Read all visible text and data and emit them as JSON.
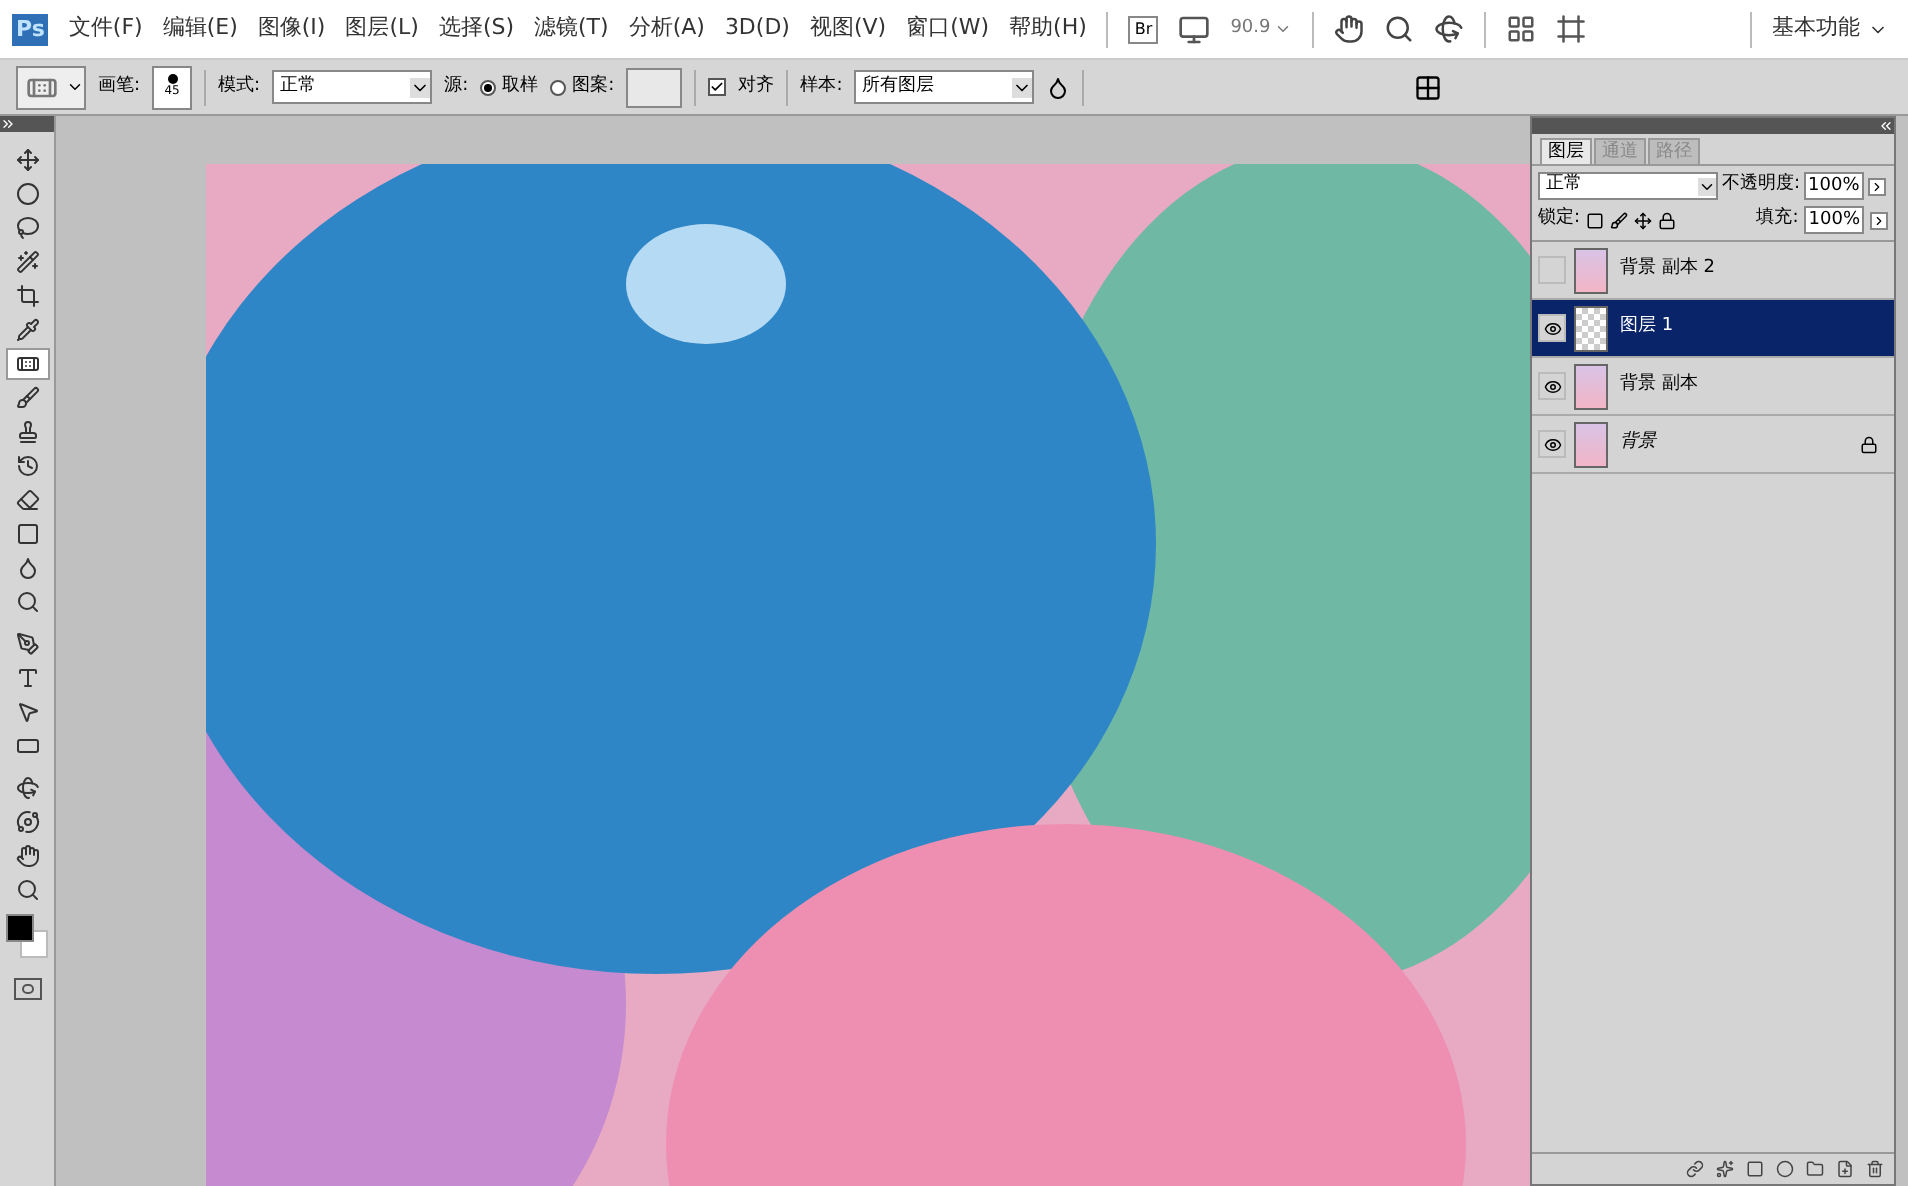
{
  "menu_bar": {
    "logo": "Ps",
    "items": [
      "文件(F)",
      "编辑(E)",
      "图像(I)",
      "图层(L)",
      "选择(S)",
      "滤镜(T)",
      "分析(A)",
      "3D(D)",
      "视图(V)",
      "窗口(W)",
      "帮助(H)"
    ],
    "bridge": "Br",
    "zoom": "90.9",
    "workspace": "基本功能"
  },
  "options_bar": {
    "brush_label": "画笔:",
    "brush_size": "45",
    "mode_label": "模式:",
    "mode_value": "正常",
    "source_label": "源:",
    "sources": [
      {
        "label": "取样",
        "selected": true
      },
      {
        "label": "图案:",
        "selected": false
      }
    ],
    "aligned": {
      "label": "对齐",
      "checked": true
    },
    "sample_label": "样本:",
    "sample_value": "所有图层"
  },
  "toolbox": {
    "tools": [
      {
        "kind": "move",
        "selected": false
      },
      {
        "kind": "marquee",
        "selected": false
      },
      {
        "kind": "lasso",
        "selected": false
      },
      {
        "kind": "wand",
        "selected": false
      },
      {
        "kind": "crop",
        "selected": false
      },
      {
        "kind": "eyedropper",
        "selected": false
      },
      {
        "kind": "healing",
        "selected": true
      },
      {
        "kind": "brush",
        "selected": false
      },
      {
        "kind": "stamp",
        "selected": false
      },
      {
        "kind": "history",
        "selected": false
      },
      {
        "kind": "eraser",
        "selected": false
      },
      {
        "kind": "gradient",
        "selected": false
      },
      {
        "kind": "blur",
        "selected": false
      },
      {
        "kind": "dodge",
        "selected": false
      },
      {
        "kind": "pen",
        "selected": false
      },
      {
        "kind": "type",
        "selected": false
      },
      {
        "kind": "select",
        "selected": false
      },
      {
        "kind": "shape",
        "selected": false
      },
      {
        "kind": "rotate3d",
        "selected": false
      },
      {
        "kind": "orbit3d",
        "selected": false
      },
      {
        "kind": "hand",
        "selected": false
      },
      {
        "kind": "zoom",
        "selected": false
      }
    ]
  },
  "layers_panel": {
    "tabs": [
      {
        "label": "图层",
        "selected": true
      },
      {
        "label": "通道",
        "selected": false
      },
      {
        "label": "路径",
        "selected": false
      }
    ],
    "blend_mode": "正常",
    "opacity_label": "不透明度:",
    "opacity": "100%",
    "lock_label": "锁定:",
    "fill_label": "填充:",
    "fill": "100%",
    "layers": [
      {
        "name": "背景 副本 2",
        "visible": false,
        "selected": false,
        "kind": "photo"
      },
      {
        "name": "图层 1",
        "visible": true,
        "selected": true,
        "kind": "transparent"
      },
      {
        "name": "背景 副本",
        "visible": true,
        "selected": false,
        "kind": "photo"
      },
      {
        "name": "背景",
        "visible": true,
        "selected": false,
        "kind": "background"
      }
    ]
  }
}
